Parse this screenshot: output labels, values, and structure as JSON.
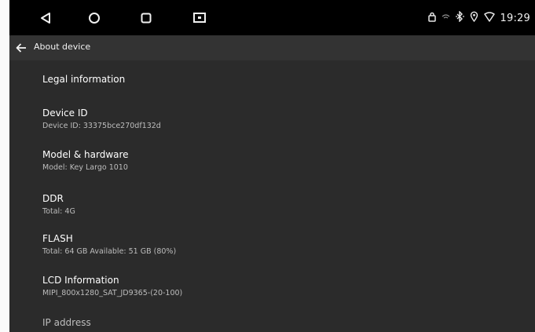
{
  "status_bar": {
    "clock": "19:29",
    "icons": [
      "lock-icon",
      "signal-icon",
      "bluetooth-icon",
      "location-icon",
      "wifi-icon"
    ]
  },
  "nav_buttons": [
    "back-triangle-icon",
    "home-circle-icon",
    "recents-square-icon",
    "screenshot-icon"
  ],
  "header": {
    "title": "About device"
  },
  "items": [
    {
      "title": "Legal information",
      "subtitle": ""
    },
    {
      "title": "Device ID",
      "subtitle": "Device ID:  33375bce270df132d"
    },
    {
      "title": "Model & hardware",
      "subtitle": "Model: Key Largo 1010"
    },
    {
      "title": "DDR",
      "subtitle": "Total: 4G"
    },
    {
      "title": "FLASH",
      "subtitle": "Total: 64 GB  Available: 51 GB (80%)"
    },
    {
      "title": "LCD Information",
      "subtitle": "MIPI_800x1280_SAT_JD9365-(20-100)"
    },
    {
      "title": "IP address",
      "subtitle": ""
    }
  ],
  "colors": {
    "background": "#2b2b2b",
    "system_bar": "#000000",
    "title_bar": "#333333",
    "primary_text": "#ffffff",
    "secondary_text": "#bdbdbd"
  }
}
